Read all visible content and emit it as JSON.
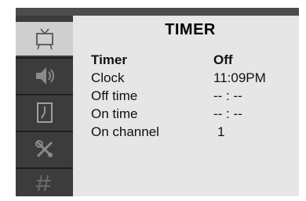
{
  "menu": {
    "title": "TIMER",
    "sidebar": [
      {
        "icon": "tv-icon",
        "selected": true
      },
      {
        "icon": "speaker-icon",
        "selected": false
      },
      {
        "icon": "clock-icon",
        "selected": false
      },
      {
        "icon": "tools-icon",
        "selected": false
      },
      {
        "icon": "channel-icon",
        "selected": false
      }
    ],
    "rows": [
      {
        "label": "Timer",
        "value": "Off"
      },
      {
        "label": "Clock",
        "value": "11:09PM"
      },
      {
        "label": "Off time",
        "value": "-- : --"
      },
      {
        "label": "On time",
        "value": "-- : --"
      },
      {
        "label": "On channel",
        "value": "1"
      }
    ]
  },
  "colors": {
    "frame": "#e6e6e6",
    "sidebar": "#3c3c3c",
    "selected_tab": "#cfcfcf"
  }
}
